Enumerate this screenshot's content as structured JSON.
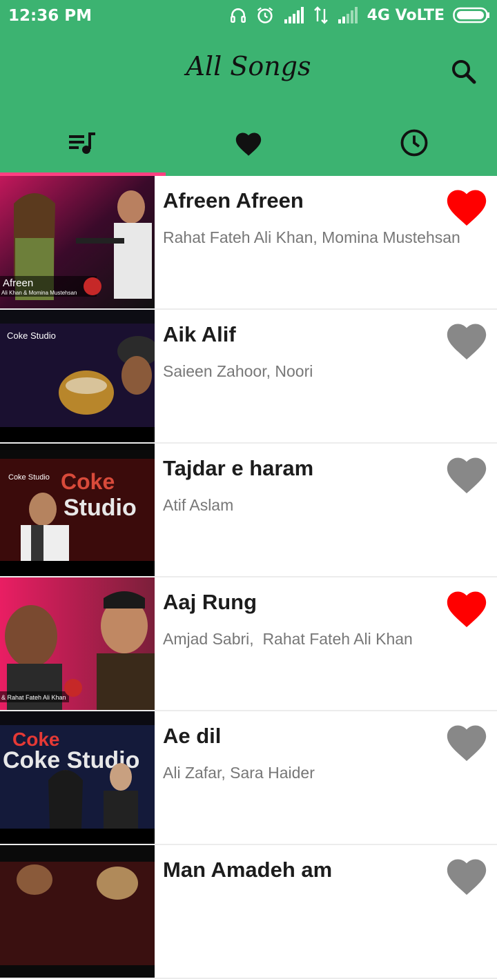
{
  "status": {
    "time": "12:36 PM",
    "network": "4G VoLTE"
  },
  "header": {
    "title": "All Songs",
    "search_icon": "search-icon"
  },
  "tabs": [
    {
      "icon": "playlist-icon",
      "selected": true
    },
    {
      "icon": "heart-icon",
      "selected": false
    },
    {
      "icon": "clock-icon",
      "selected": false
    }
  ],
  "songs": [
    {
      "title": "Afreen Afreen",
      "artists": "Rahat Fateh Ali Khan, Momina Mustehsan",
      "favorite": true,
      "thumb_caption": "Afreen",
      "thumb_sub": "Ali Khan & Momina Mustehsan"
    },
    {
      "title": "Aik Alif",
      "artists": "Saieen Zahoor, Noori",
      "favorite": false,
      "thumb_caption": "Coke Studio"
    },
    {
      "title": "Tajdar e haram",
      "artists": "Atif Aslam",
      "favorite": false,
      "thumb_caption": "Coke Studio"
    },
    {
      "title": "Aaj Rung",
      "artists": "Amjad Sabri,  Rahat Fateh Ali Khan",
      "favorite": true,
      "thumb_caption": "& Rahat Fateh Ali Khan"
    },
    {
      "title": "Ae dil",
      "artists": "Ali Zafar, Sara Haider",
      "favorite": false,
      "thumb_caption": "Coke Studio"
    },
    {
      "title": "Man Amadeh am",
      "artists": "",
      "favorite": false
    }
  ],
  "colors": {
    "primary": "#3cb371",
    "accent": "#ff4081",
    "favorite_on": "#ff0000",
    "favorite_off": "#888888"
  }
}
